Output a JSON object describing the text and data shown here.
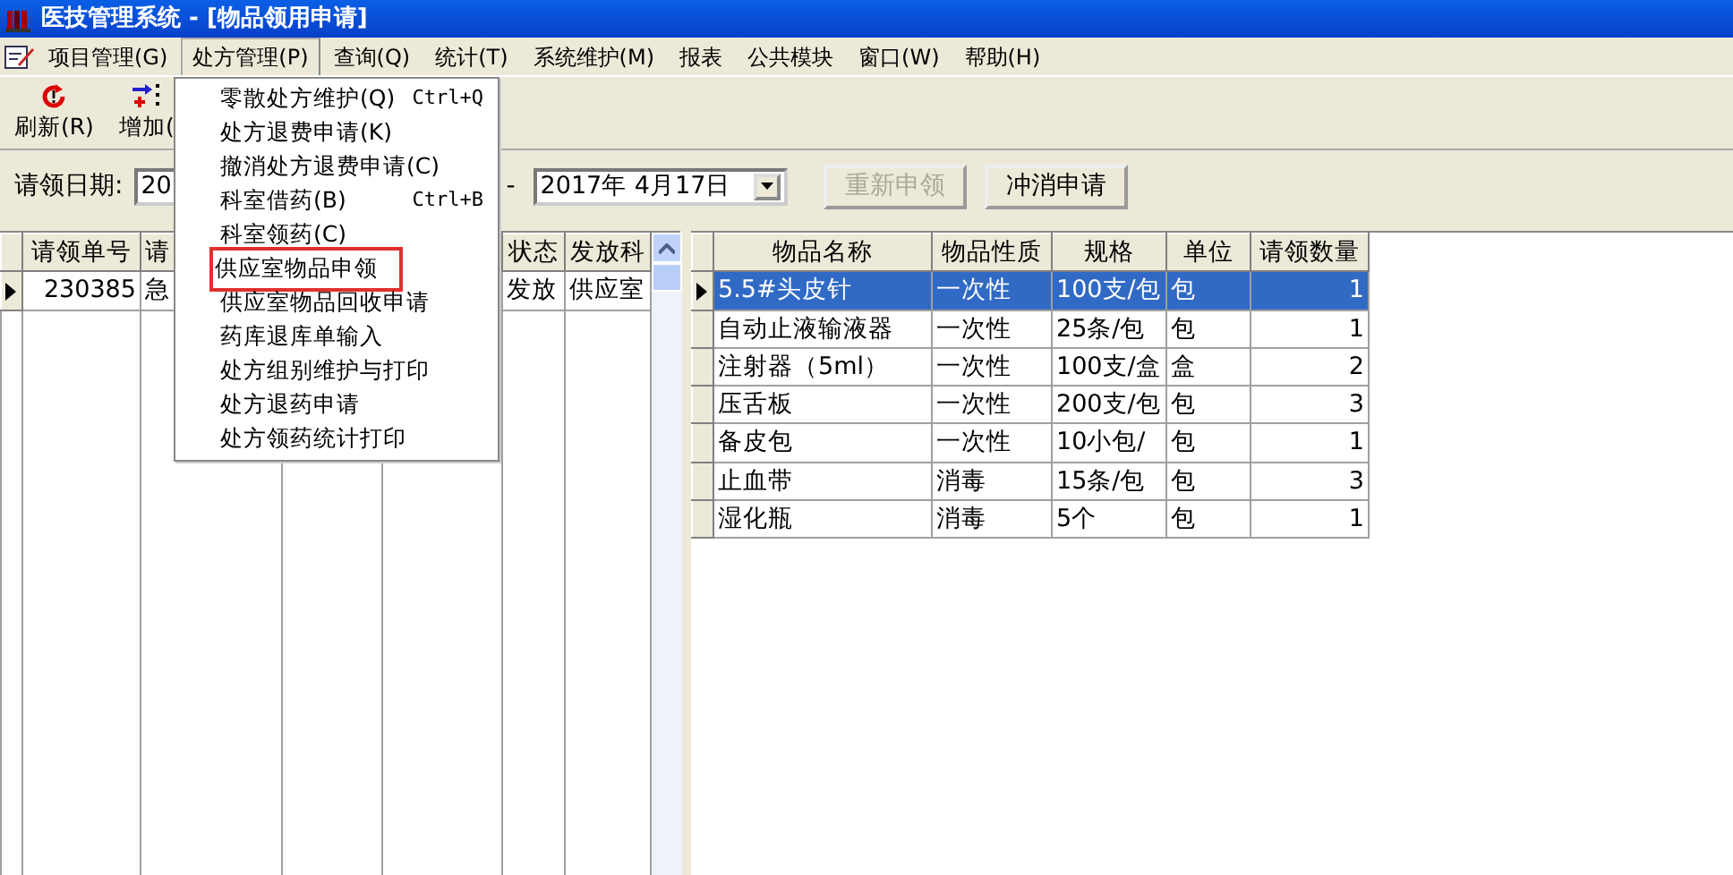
{
  "window": {
    "title": "医技管理系统 - [物品领用申请]"
  },
  "menu_bar": [
    {
      "label": "项目管理(G)",
      "open": false
    },
    {
      "label": "处方管理(P)",
      "open": true
    },
    {
      "label": "查询(Q)",
      "open": false
    },
    {
      "label": "统计(T)",
      "open": false
    },
    {
      "label": "系统维护(M)",
      "open": false
    },
    {
      "label": "报表",
      "open": false
    },
    {
      "label": "公共模块",
      "open": false
    },
    {
      "label": "窗口(W)",
      "open": false
    },
    {
      "label": "帮助(H)",
      "open": false
    }
  ],
  "toolbar": [
    {
      "label": "刷新(R)",
      "kind": "refresh"
    },
    {
      "label": "增加(",
      "kind": "add"
    }
  ],
  "filter": {
    "label": "请领日期:",
    "date_from": "20",
    "separator": "-",
    "date_to": "2017年 4月17日"
  },
  "buttons": [
    {
      "label": "重新申领",
      "disabled": true
    },
    {
      "label": "冲消申请",
      "disabled": false
    }
  ],
  "requests_table": {
    "columns": [
      "请领单号",
      "请",
      "状态",
      "发放科"
    ],
    "rows": [
      {
        "cells": [
          "230385",
          "急",
          "发放",
          "供应室"
        ],
        "selected": true
      }
    ]
  },
  "items_table": {
    "columns": [
      "物品名称",
      "物品性质",
      "规格",
      "单位",
      "请领数量"
    ],
    "rows": [
      {
        "cells": [
          "5.5#头皮针",
          "一次性",
          "100支/包",
          "包",
          "1"
        ],
        "selected": true
      },
      {
        "cells": [
          "自动止液输液器",
          "一次性",
          "25条/包",
          "包",
          "1"
        ],
        "selected": false
      },
      {
        "cells": [
          "注射器（5ml）",
          "一次性",
          "100支/盒",
          "盒",
          "2"
        ],
        "selected": false
      },
      {
        "cells": [
          "压舌板",
          "一次性",
          "200支/包",
          "包",
          "3"
        ],
        "selected": false
      },
      {
        "cells": [
          "备皮包",
          "一次性",
          "10小包/",
          "包",
          "1"
        ],
        "selected": false
      },
      {
        "cells": [
          "止血带",
          "消毒",
          "15条/包",
          "包",
          "3"
        ],
        "selected": false
      },
      {
        "cells": [
          "湿化瓶",
          "消毒",
          "5个",
          "包",
          "1"
        ],
        "selected": false
      }
    ]
  },
  "dropdown_menu": {
    "items": [
      {
        "label": "零散处方维护(Q)",
        "shortcut": "Ctrl+Q",
        "highlighted": false
      },
      {
        "label": "处方退费申请(K)",
        "highlighted": false
      },
      {
        "label": "撤消处方退费申请(C)",
        "highlighted": false
      },
      {
        "label": "科室借药(B)",
        "shortcut": "Ctrl+B",
        "highlighted": false
      },
      {
        "label": "科室领药(C)",
        "highlighted": false
      },
      {
        "label": "供应室物品申领",
        "highlighted": true
      },
      {
        "label": "供应室物品回收申请",
        "highlighted": false
      },
      {
        "label": "药库退库单输入",
        "highlighted": false
      },
      {
        "label": "处方组别维护与打印",
        "highlighted": false
      },
      {
        "label": "处方退药申请",
        "highlighted": false
      },
      {
        "label": "处方领药统计打印",
        "highlighted": false
      }
    ]
  }
}
